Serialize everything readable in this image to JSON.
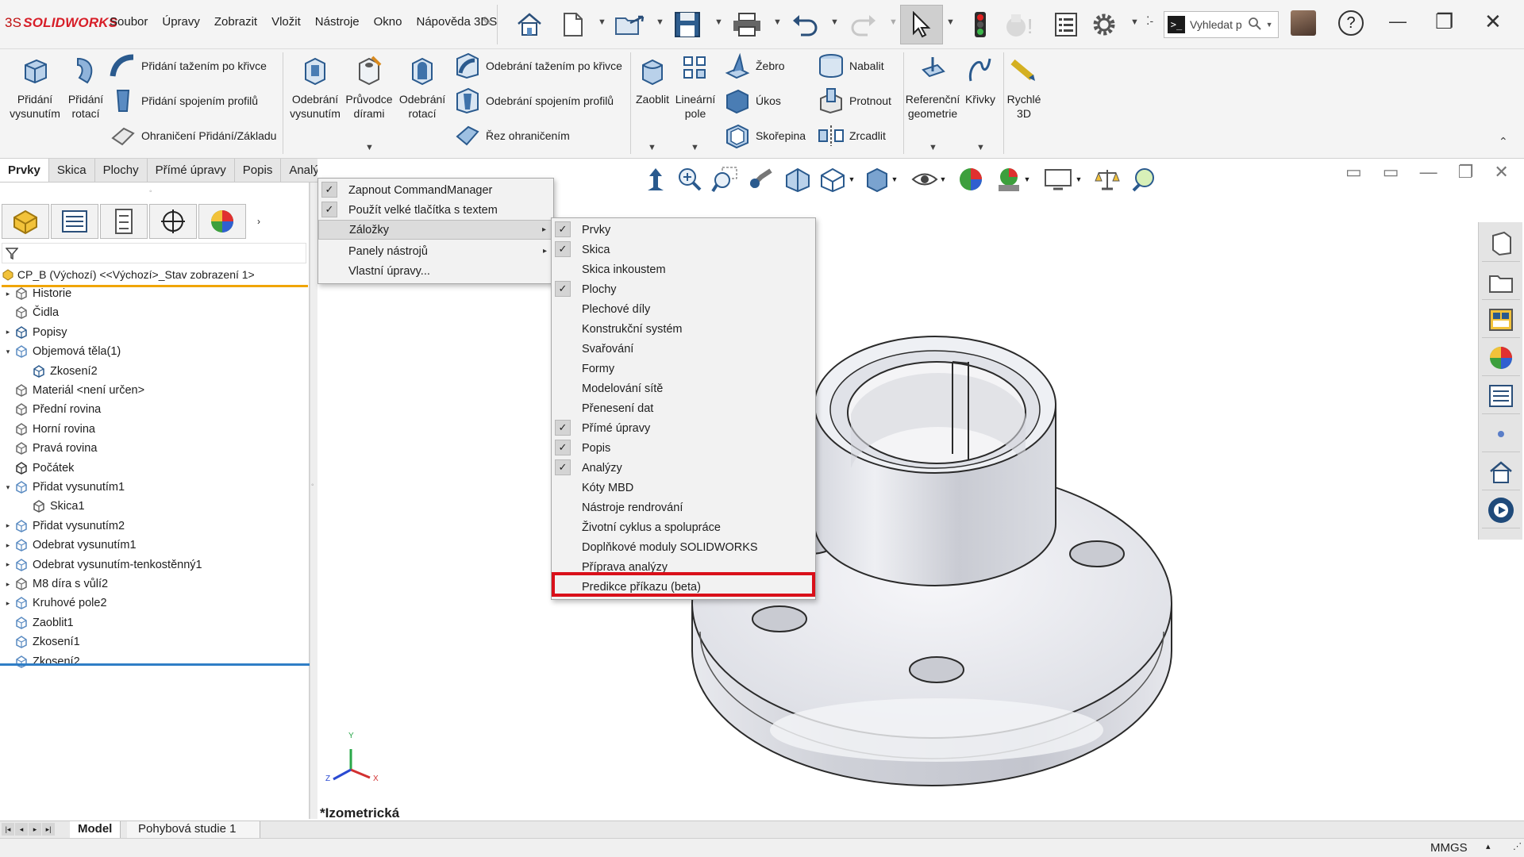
{
  "app": {
    "logo_text": "SOLIDWORKS",
    "logo_mark": "3S"
  },
  "menubar": {
    "items": [
      "Soubor",
      "Úpravy",
      "Zobrazit",
      "Vložit",
      "Nástroje",
      "Okno",
      "Nápověda 3DS"
    ],
    "pin": "✎"
  },
  "search": {
    "placeholder": "Vyhledat p",
    "prompt": ">_"
  },
  "window": {
    "help": "?",
    "minimize": "—",
    "restore": "❐",
    "close": "✕"
  },
  "ribbon": {
    "extrude_boss": [
      "Přidání",
      "vysunutím"
    ],
    "revolve_boss": [
      "Přidání",
      "rotací"
    ],
    "swept_boss": "Přidání tažením po křivce",
    "lofted_boss": "Přidání spojením profilů",
    "boundary_boss": "Ohraničení Přidání/Základu",
    "extruded_cut": [
      "Odebrání",
      "vysunutím"
    ],
    "hole_wizard": [
      "Průvodce",
      "dírami"
    ],
    "revolved_cut": [
      "Odebrání",
      "rotací"
    ],
    "swept_cut": "Odebrání tažením po křivce",
    "lofted_cut": "Odebrání spojením profilů",
    "boundary_cut": "Řez ohraničením",
    "fillet": "Zaoblit",
    "linear_pattern": [
      "Lineární",
      "pole"
    ],
    "rib": "Žebro",
    "draft": "Úkos",
    "shell": "Skořepina",
    "wrap": "Nabalit",
    "intersect": "Protnout",
    "mirror": "Zrcadlit",
    "ref_geometry": [
      "Referenční",
      "geometrie"
    ],
    "curves": "Křivky",
    "instant3d": [
      "Rychlé",
      "3D"
    ]
  },
  "tabs": [
    {
      "label": "Prvky",
      "active": true
    },
    {
      "label": "Skica",
      "active": false
    },
    {
      "label": "Plochy",
      "active": false
    },
    {
      "label": "Přímé úpravy",
      "active": false
    },
    {
      "label": "Popis",
      "active": false
    },
    {
      "label": "Analýzy",
      "active": false
    }
  ],
  "tree": {
    "root": "CP_B (Výchozí) <<Výchozí>_Stav zobrazení 1>",
    "nodes": [
      {
        "label": "Historie",
        "expand": "▸",
        "icon": "history"
      },
      {
        "label": "Čidla",
        "expand": "",
        "icon": "sensor"
      },
      {
        "label": "Popisy",
        "expand": "▸",
        "icon": "annotation"
      },
      {
        "label": "Objemová těla(1)",
        "expand": "▾",
        "icon": "solid"
      },
      {
        "label": "Zkosení2",
        "expand": "",
        "icon": "body",
        "indent": 1
      },
      {
        "label": "Materiál <není určen>",
        "expand": "",
        "icon": "material"
      },
      {
        "label": "Přední rovina",
        "expand": "",
        "icon": "plane"
      },
      {
        "label": "Horní rovina",
        "expand": "",
        "icon": "plane"
      },
      {
        "label": "Pravá rovina",
        "expand": "",
        "icon": "plane"
      },
      {
        "label": "Počátek",
        "expand": "",
        "icon": "origin"
      },
      {
        "label": "Přidat vysunutím1",
        "expand": "▾",
        "icon": "boss"
      },
      {
        "label": "Skica1",
        "expand": "",
        "icon": "sketch",
        "indent": 1
      },
      {
        "label": "Přidat vysunutím2",
        "expand": "▸",
        "icon": "boss"
      },
      {
        "label": "Odebrat vysunutím1",
        "expand": "▸",
        "icon": "cut"
      },
      {
        "label": "Odebrat vysunutím-tenkostěnný1",
        "expand": "▸",
        "icon": "cut"
      },
      {
        "label": "M8 díra s vůlí2",
        "expand": "▸",
        "icon": "hole"
      },
      {
        "label": "Kruhové pole2",
        "expand": "▸",
        "icon": "pattern"
      },
      {
        "label": "Zaoblit1",
        "expand": "",
        "icon": "fillet"
      },
      {
        "label": "Zkosení1",
        "expand": "",
        "icon": "chamfer"
      },
      {
        "label": "Zkosení2",
        "expand": "",
        "icon": "chamfer"
      }
    ]
  },
  "context_menu": {
    "items": [
      {
        "label": "Zapnout CommandManager",
        "checked": true,
        "submenu": false
      },
      {
        "label": "Použít velké tlačítka s textem",
        "checked": true,
        "submenu": false
      },
      {
        "label": "Záložky",
        "checked": false,
        "submenu": true,
        "highlight": true
      },
      {
        "label": "Panely nástrojů",
        "checked": false,
        "submenu": true
      },
      {
        "label": "Vlastní úpravy...",
        "checked": false,
        "submenu": false
      }
    ]
  },
  "tabs_submenu": {
    "items": [
      {
        "label": "Prvky",
        "checked": true
      },
      {
        "label": "Skica",
        "checked": true
      },
      {
        "label": "Skica inkoustem",
        "checked": false
      },
      {
        "label": "Plochy",
        "checked": true
      },
      {
        "label": "Plechové díly",
        "checked": false
      },
      {
        "label": "Konstrukční systém",
        "checked": false
      },
      {
        "label": "Svařování",
        "checked": false
      },
      {
        "label": "Formy",
        "checked": false
      },
      {
        "label": "Modelování sítě",
        "checked": false
      },
      {
        "label": "Přenesení dat",
        "checked": false
      },
      {
        "label": "Přímé úpravy",
        "checked": true
      },
      {
        "label": "Popis",
        "checked": true
      },
      {
        "label": "Analýzy",
        "checked": true
      },
      {
        "label": "Kóty MBD",
        "checked": false
      },
      {
        "label": "Nástroje rendrování",
        "checked": false
      },
      {
        "label": "Životní cyklus a spolupráce",
        "checked": false
      },
      {
        "label": "Doplňkové moduly SOLIDWORKS",
        "checked": false
      },
      {
        "label": "Příprava analýzy",
        "checked": false
      },
      {
        "label": "Predikce příkazu (beta)",
        "checked": false
      }
    ],
    "highlight_color": "#d9101a"
  },
  "viewport": {
    "view_name": "*Izometrická",
    "triad": {
      "x": "X",
      "y": "Y",
      "z": "Z"
    }
  },
  "bottom_tabs": [
    {
      "label": "Model",
      "active": true
    },
    {
      "label": "Pohybová studie 1",
      "active": false
    }
  ],
  "status": {
    "units": "MMGS",
    "arrow": "▴"
  },
  "colors": {
    "accent": "#d71e28",
    "tree_root_line": "#f0a500",
    "tree_end_line": "#2f7ec6",
    "ribbon_bg": "#f4f4f4"
  }
}
